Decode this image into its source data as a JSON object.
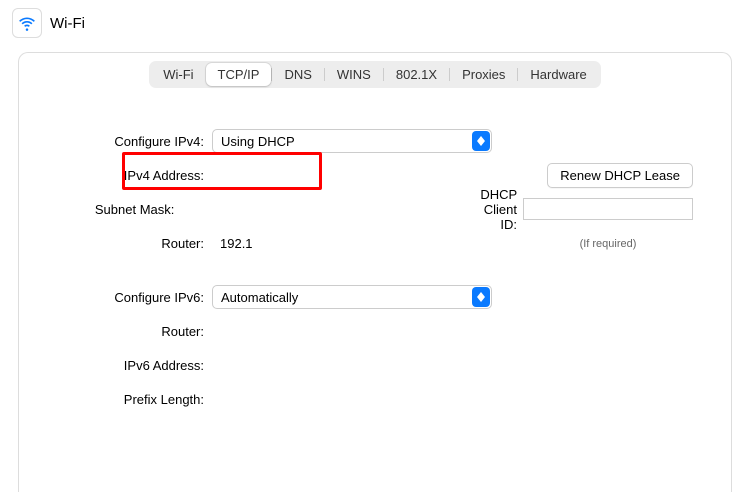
{
  "header": {
    "title": "Wi-Fi",
    "icon": "wifi-icon"
  },
  "tabs": [
    "Wi-Fi",
    "TCP/IP",
    "DNS",
    "WINS",
    "802.1X",
    "Proxies",
    "Hardware"
  ],
  "active_tab_index": 1,
  "ipv4": {
    "configure_label": "Configure IPv4:",
    "configure_value": "Using DHCP",
    "address_label": "IPv4 Address:",
    "address_value": "",
    "subnet_label": "Subnet Mask:",
    "subnet_value": "",
    "router_label": "Router:",
    "router_value": "192.1"
  },
  "dhcp": {
    "renew_label": "Renew DHCP Lease",
    "client_id_label": "DHCP Client ID:",
    "client_id_value": "",
    "hint": "(If required)"
  },
  "ipv6": {
    "configure_label": "Configure IPv6:",
    "configure_value": "Automatically",
    "router_label": "Router:",
    "router_value": "",
    "address_label": "IPv6 Address:",
    "address_value": "",
    "prefix_label": "Prefix Length:",
    "prefix_value": ""
  }
}
